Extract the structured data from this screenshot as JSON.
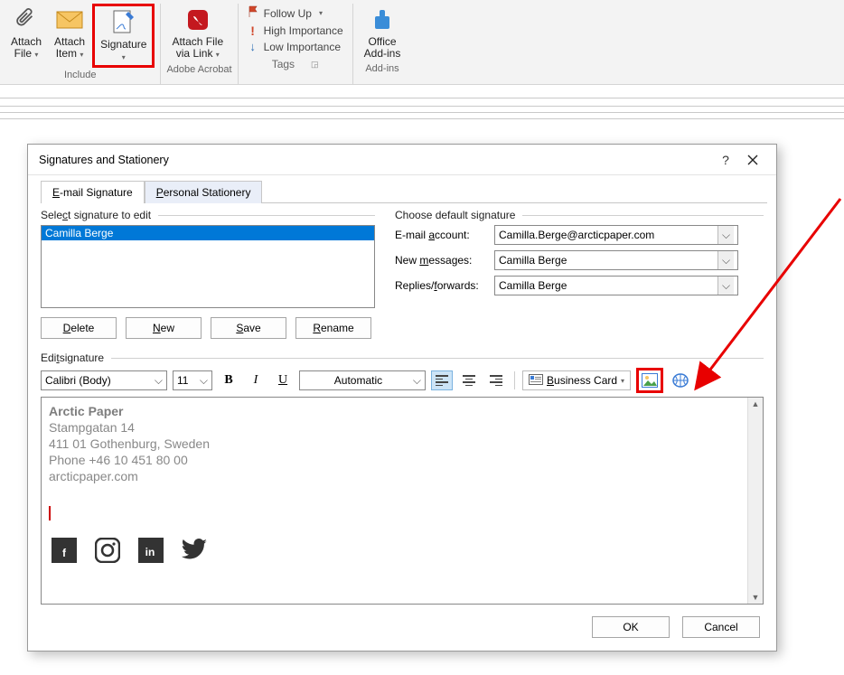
{
  "ribbon": {
    "attach_file": "Attach\nFile",
    "attach_item": "Attach\nItem",
    "signature": "Signature",
    "attach_via_link": "Attach File\nvia Link",
    "follow_up": "Follow Up",
    "high_importance": "High Importance",
    "low_importance": "Low Importance",
    "office_addins": "Office\nAdd-ins",
    "group_include": "Include",
    "group_adobe": "Adobe Acrobat",
    "group_tags": "Tags",
    "group_addins": "Add-ins"
  },
  "dialog": {
    "title": "Signatures and Stationery",
    "tabs": {
      "email_sig": "E-mail Signature",
      "personal": "Personal Stationery"
    },
    "select_label": "Select signature to edit",
    "sig_list": [
      "Camilla Berge"
    ],
    "buttons": {
      "delete": "Delete",
      "new": "New",
      "save": "Save",
      "rename": "Rename"
    },
    "defaults": {
      "label": "Choose default signature",
      "email_account_lbl": "E-mail account:",
      "email_account_val": "Camilla.Berge@arcticpaper.com",
      "new_messages_lbl": "New messages:",
      "new_messages_val": "Camilla Berge",
      "replies_lbl": "Replies/forwards:",
      "replies_val": "Camilla Berge"
    },
    "edit_label": "Edit signature",
    "toolbar": {
      "font": "Calibri (Body)",
      "size": "11",
      "automatic": "Automatic",
      "business_card": "Business Card"
    },
    "editor": {
      "l1": "Arctic Paper",
      "l2": "Stampgatan 14",
      "l3": "411 01 Gothenburg, Sweden",
      "l4": "Phone +46 10 451 80 00",
      "l5": "arcticpaper.com"
    },
    "ok": "OK",
    "cancel": "Cancel"
  }
}
